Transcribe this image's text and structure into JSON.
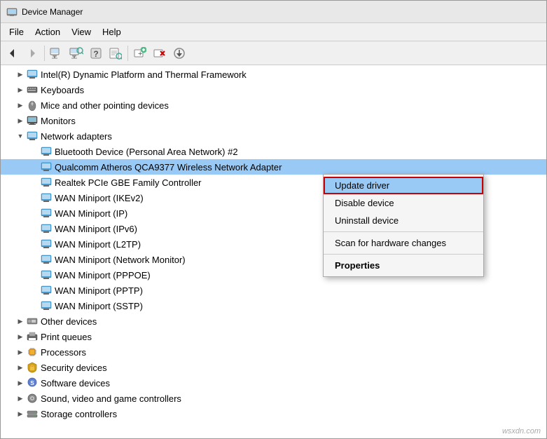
{
  "window": {
    "title": "Device Manager"
  },
  "menu": {
    "items": [
      "File",
      "Action",
      "View",
      "Help"
    ]
  },
  "toolbar": {
    "buttons": [
      {
        "name": "back",
        "icon": "◀"
      },
      {
        "name": "forward",
        "icon": "▶"
      },
      {
        "name": "properties",
        "icon": "🗒"
      },
      {
        "name": "update-driver",
        "icon": "📄"
      },
      {
        "name": "help",
        "icon": "❓"
      },
      {
        "name": "scan",
        "icon": "📋"
      },
      {
        "name": "delete",
        "icon": "✖"
      },
      {
        "name": "download",
        "icon": "⊕"
      }
    ]
  },
  "tree": {
    "items": [
      {
        "label": "Intel(R) Dynamic Platform and Thermal Framework",
        "indent": 1,
        "expanded": false,
        "icon": "processor"
      },
      {
        "label": "Keyboards",
        "indent": 1,
        "expanded": false,
        "icon": "keyboard"
      },
      {
        "label": "Mice and other pointing devices",
        "indent": 1,
        "expanded": false,
        "icon": "mouse"
      },
      {
        "label": "Monitors",
        "indent": 1,
        "expanded": false,
        "icon": "monitor"
      },
      {
        "label": "Network adapters",
        "indent": 1,
        "expanded": true,
        "icon": "network"
      },
      {
        "label": "Bluetooth Device (Personal Area Network) #2",
        "indent": 2,
        "expanded": false,
        "icon": "network-adapter",
        "selected": false
      },
      {
        "label": "Qualcomm Atheros QCA9377 Wireless Network Adapter",
        "indent": 2,
        "expanded": false,
        "icon": "network-adapter",
        "selected": true
      },
      {
        "label": "Realtek PCIe GBE Family Controller",
        "indent": 2,
        "expanded": false,
        "icon": "network-adapter"
      },
      {
        "label": "WAN Miniport (IKEv2)",
        "indent": 2,
        "expanded": false,
        "icon": "network-adapter"
      },
      {
        "label": "WAN Miniport (IP)",
        "indent": 2,
        "expanded": false,
        "icon": "network-adapter"
      },
      {
        "label": "WAN Miniport (IPv6)",
        "indent": 2,
        "expanded": false,
        "icon": "network-adapter"
      },
      {
        "label": "WAN Miniport (L2TP)",
        "indent": 2,
        "expanded": false,
        "icon": "network-adapter"
      },
      {
        "label": "WAN Miniport (Network Monitor)",
        "indent": 2,
        "expanded": false,
        "icon": "network-adapter"
      },
      {
        "label": "WAN Miniport (PPPOE)",
        "indent": 2,
        "expanded": false,
        "icon": "network-adapter"
      },
      {
        "label": "WAN Miniport (PPTP)",
        "indent": 2,
        "expanded": false,
        "icon": "network-adapter"
      },
      {
        "label": "WAN Miniport (SSTP)",
        "indent": 2,
        "expanded": false,
        "icon": "network-adapter"
      },
      {
        "label": "Other devices",
        "indent": 1,
        "expanded": false,
        "icon": "other"
      },
      {
        "label": "Print queues",
        "indent": 1,
        "expanded": false,
        "icon": "print"
      },
      {
        "label": "Processors",
        "indent": 1,
        "expanded": false,
        "icon": "processor2"
      },
      {
        "label": "Security devices",
        "indent": 1,
        "expanded": false,
        "icon": "security"
      },
      {
        "label": "Software devices",
        "indent": 1,
        "expanded": false,
        "icon": "software"
      },
      {
        "label": "Sound, video and game controllers",
        "indent": 1,
        "expanded": false,
        "icon": "sound"
      },
      {
        "label": "Storage controllers",
        "indent": 1,
        "expanded": false,
        "icon": "storage"
      }
    ]
  },
  "contextMenu": {
    "items": [
      {
        "label": "Update driver",
        "type": "highlighted"
      },
      {
        "label": "Disable device",
        "type": "normal"
      },
      {
        "label": "Uninstall device",
        "type": "normal"
      },
      {
        "separator": true
      },
      {
        "label": "Scan for hardware changes",
        "type": "normal"
      },
      {
        "separator": true
      },
      {
        "label": "Properties",
        "type": "bold"
      }
    ]
  },
  "watermark": "wsxdn.com"
}
